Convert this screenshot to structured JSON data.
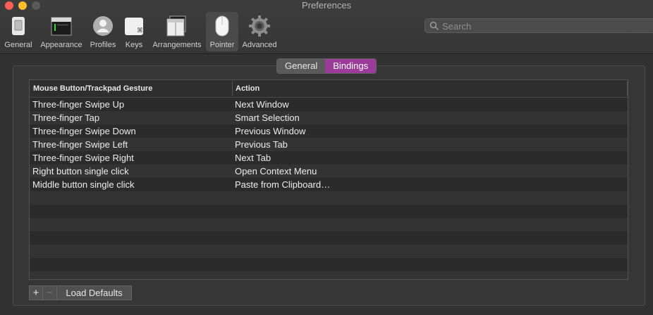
{
  "window": {
    "title": "Preferences"
  },
  "toolbar": {
    "items": [
      {
        "label": "General",
        "icon": "general-icon"
      },
      {
        "label": "Appearance",
        "icon": "appearance-icon"
      },
      {
        "label": "Profiles",
        "icon": "profiles-icon"
      },
      {
        "label": "Keys",
        "icon": "keys-icon"
      },
      {
        "label": "Arrangements",
        "icon": "arrangements-icon"
      },
      {
        "label": "Pointer",
        "icon": "pointer-icon",
        "selected": true
      },
      {
        "label": "Advanced",
        "icon": "gear-icon"
      }
    ]
  },
  "search": {
    "placeholder": "Search",
    "value": ""
  },
  "tabs": [
    {
      "label": "General",
      "active": false
    },
    {
      "label": "Bindings",
      "active": true
    }
  ],
  "table": {
    "headers": [
      "Mouse Button/Trackpad Gesture",
      "Action"
    ],
    "rows": [
      [
        "Three-finger Swipe Up",
        "Next Window"
      ],
      [
        "Three-finger Tap",
        "Smart Selection"
      ],
      [
        "Three-finger Swipe Down",
        "Previous Window"
      ],
      [
        "Three-finger Swipe Left",
        "Previous Tab"
      ],
      [
        "Three-finger Swipe Right",
        "Next Tab"
      ],
      [
        "Right button single click",
        "Open Context Menu"
      ],
      [
        "Middle button single click",
        "Paste from Clipboard…"
      ],
      [
        "",
        ""
      ],
      [
        "",
        ""
      ],
      [
        "",
        ""
      ],
      [
        "",
        ""
      ],
      [
        "",
        ""
      ],
      [
        "",
        ""
      ],
      [
        "",
        ""
      ]
    ]
  },
  "buttons": {
    "add": "+",
    "remove": "−",
    "load_defaults": "Load Defaults"
  },
  "colors": {
    "accent": "#9b3c9b",
    "close": "#fe5f57",
    "minimize": "#febc2e"
  }
}
